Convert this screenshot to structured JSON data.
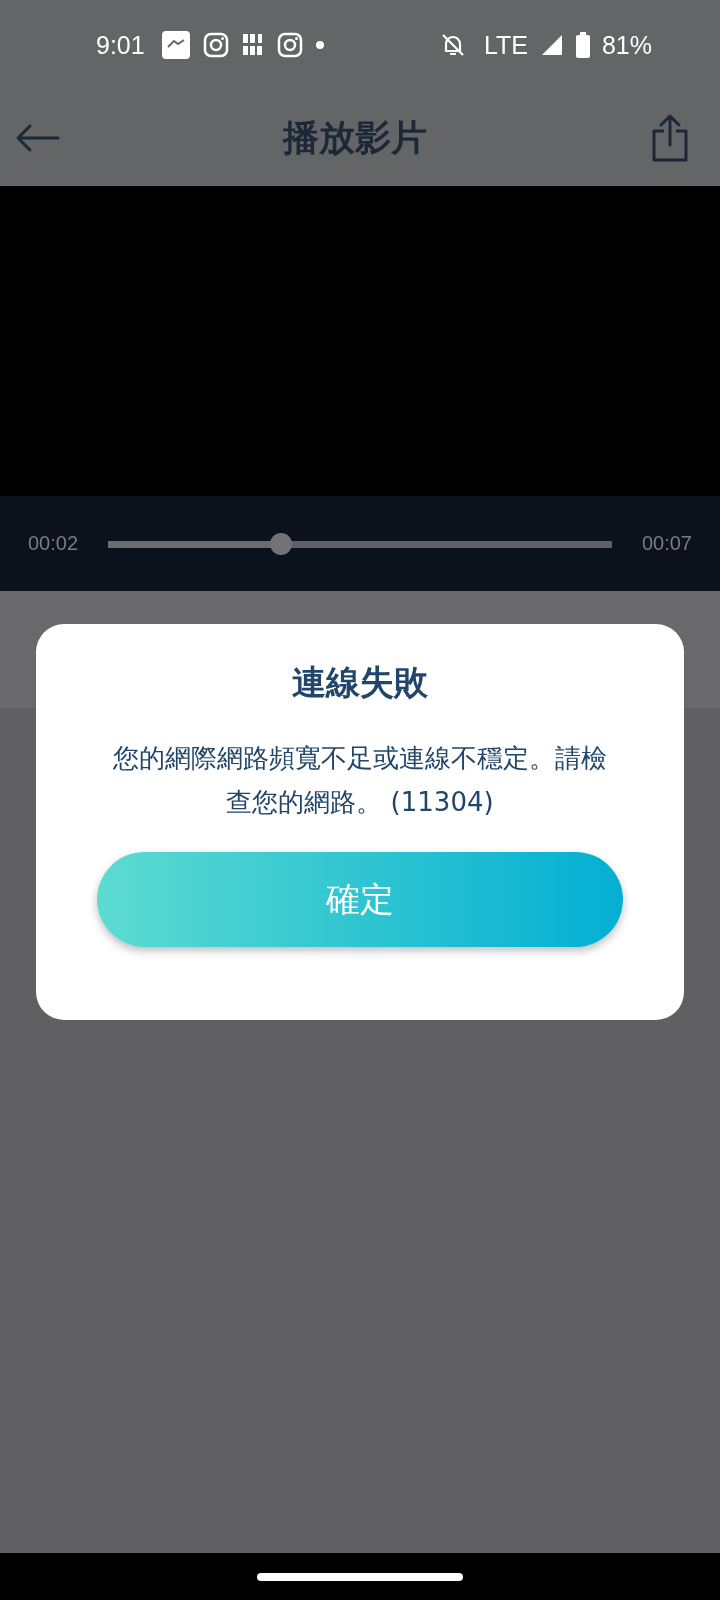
{
  "status_bar": {
    "time": "9:01",
    "battery": "81%",
    "network": "LTE"
  },
  "app_bar": {
    "title": "播放影片"
  },
  "player": {
    "elapsed": "00:02",
    "duration": "00:07",
    "level": 0.344
  },
  "dialog": {
    "title": "連線失敗",
    "message": "您的網際網路頻寬不足或連線不穩定。請檢查您的網路。 (11304)",
    "button": "確定"
  }
}
